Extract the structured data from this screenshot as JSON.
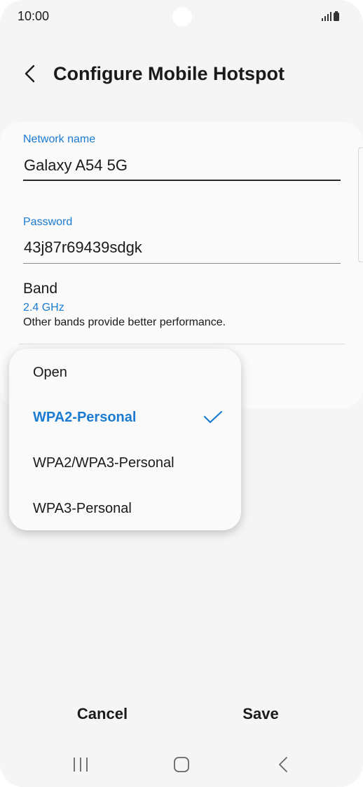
{
  "status_bar": {
    "time": "10:00",
    "icons": [
      "signal-icon",
      "battery-icon"
    ]
  },
  "header": {
    "title": "Configure Mobile Hotspot",
    "back_icon": "chevron-left-icon"
  },
  "network_name": {
    "label": "Network name",
    "value": "Galaxy A54 5G"
  },
  "password": {
    "label": "Password",
    "value": "43j87r69439sdgk"
  },
  "band": {
    "label": "Band",
    "value": "2.4 GHz",
    "description": "Other bands provide better performance."
  },
  "security_menu": {
    "options": [
      {
        "label": "Open",
        "selected": false
      },
      {
        "label": "WPA2-Personal",
        "selected": true
      },
      {
        "label": "WPA2/WPA3-Personal",
        "selected": false
      },
      {
        "label": "WPA3-Personal",
        "selected": false
      }
    ]
  },
  "actions": {
    "cancel_label": "Cancel",
    "save_label": "Save"
  },
  "nav_bar": {
    "icons": [
      "recents-icon",
      "home-icon",
      "back-icon"
    ]
  },
  "colors": {
    "accent": "#1a7bd0",
    "background": "#f5f5f5",
    "card": "#fafafa",
    "text": "#1a1a1a"
  }
}
